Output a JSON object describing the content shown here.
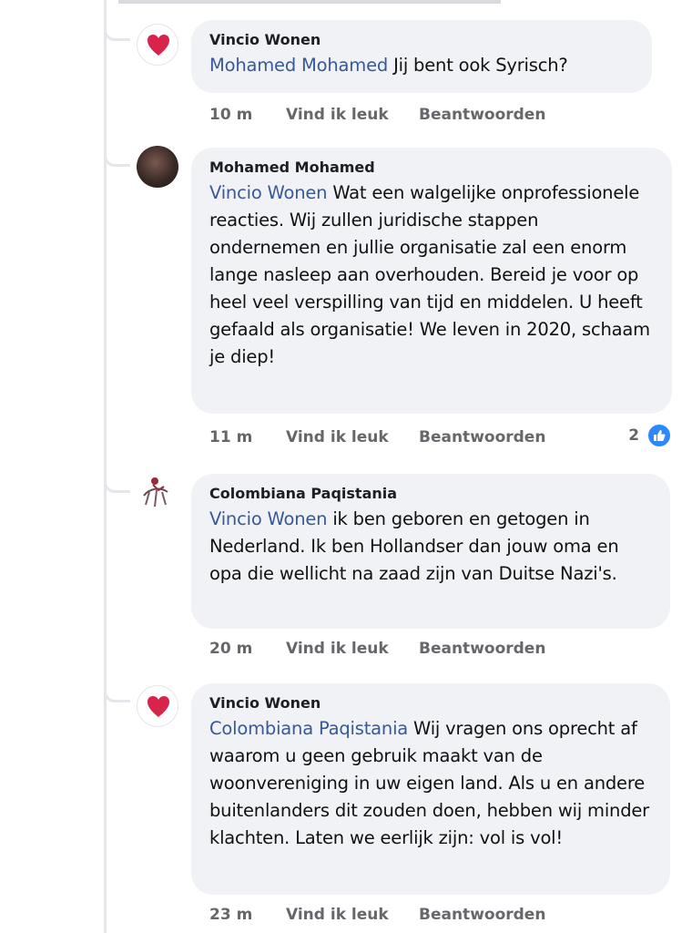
{
  "comments": [
    {
      "author": "Vincio Wonen",
      "mention": "Mohamed Mohamed",
      "text": " Jij bent ook Syrisch?",
      "time": "10 m",
      "like_label": "Vind ik leuk",
      "reply_label": "Beantwoorden",
      "avatar_icon": "heart-icon"
    },
    {
      "author": "Mohamed Mohamed",
      "mention": "Vincio Wonen",
      "text": " Wat een walgelijke onprofessionele reacties. Wij zullen juridische stappen ondernemen en jullie organisatie zal een enorm lange nasleep aan overhouden. Bereid je voor op heel veel verspilling van tijd en middelen. U heeft gefaald als organisatie! We leven in 2020, schaam je diep!",
      "time": "11 m",
      "like_label": "Vind ik leuk",
      "reply_label": "Beantwoorden",
      "reaction_count": "2",
      "reaction_icon": "thumbs-up-icon"
    },
    {
      "author": "Colombiana Paqistania",
      "mention": "Vincio Wonen",
      "text": " ik ben geboren en getogen in Nederland. Ik ben Hollandser dan jouw oma en opa die wellicht na zaad zijn van Duitse Nazi's.",
      "time": "20 m",
      "like_label": "Vind ik leuk",
      "reply_label": "Beantwoorden"
    },
    {
      "author": "Vincio Wonen",
      "mention": "Colombiana Paqistania",
      "text": " Wij vragen ons oprecht af waarom u geen gebruik maakt van de woonvereniging in uw eigen land. Als u en andere buitenlanders dit zouden doen, hebben wij minder klachten. Laten we eerlijk zijn: vol is vol!",
      "time": "23 m",
      "like_label": "Vind ik leuk",
      "reply_label": "Beantwoorden",
      "avatar_icon": "heart-icon"
    }
  ],
  "colors": {
    "mention": "#385898",
    "bubble": "#f0f2f5",
    "meta": "#65676b",
    "heart": "#d8234a",
    "like": "#2d88ff"
  }
}
